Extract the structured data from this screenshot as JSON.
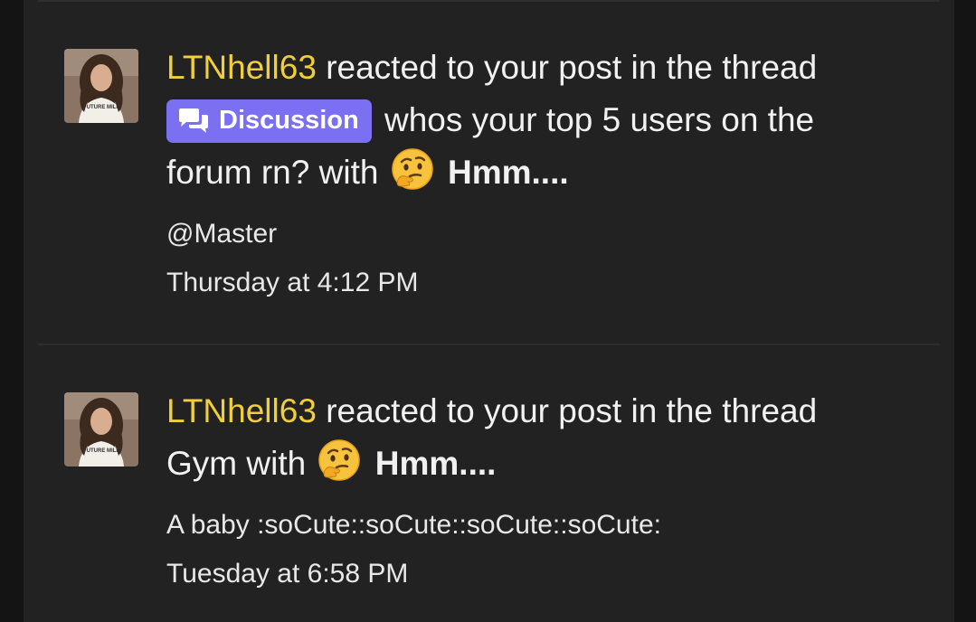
{
  "alerts": [
    {
      "username": "LTNhell63",
      "action_text": "reacted to your post in the thread",
      "prefix_label": "Discussion",
      "thread_title_line1": "whos your top 5 users on the",
      "thread_title_line2": "forum rn?",
      "with_text": "with",
      "reaction_name": "Hmm....",
      "snippet": "@Master",
      "time": "Thursday at 4:12 PM",
      "avatar_shirt_text": "FUTURE MILF"
    },
    {
      "username": "LTNhell63",
      "action_text": "reacted to your post in the thread",
      "thread_title": "Gym",
      "with_text": "with",
      "reaction_name": "Hmm....",
      "snippet": "A baby :soCute::soCute::soCute::soCute:",
      "time": "Tuesday at 6:58 PM",
      "avatar_shirt_text": "FUTURE MILF"
    }
  ],
  "colors": {
    "background": "#222222",
    "page_bg": "#141414",
    "username": "#f0cf3a",
    "prefix_bg": "#7b6ff2",
    "text": "#f1f1f1"
  },
  "icons": {
    "prefix_icon": "chat-bubbles-icon",
    "reaction_icon": "thinking-face-emoji"
  }
}
